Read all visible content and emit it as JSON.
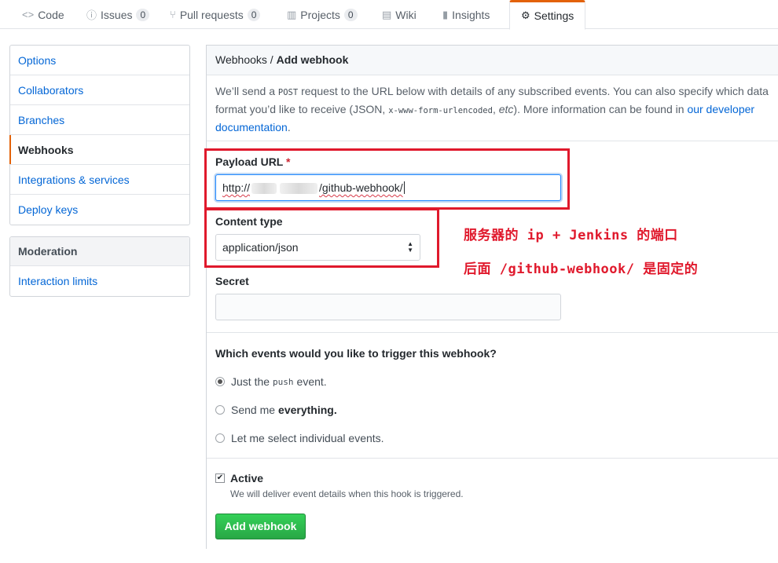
{
  "nav": {
    "tabs": [
      {
        "icon": "code-icon",
        "glyph": "<>",
        "label": "Code"
      },
      {
        "icon": "issue-icon",
        "glyph": "ⓘ",
        "label": "Issues",
        "count": "0"
      },
      {
        "icon": "pull-request-icon",
        "glyph": "⑂",
        "label": "Pull requests",
        "count": "0"
      },
      {
        "icon": "project-icon",
        "glyph": "▥",
        "label": "Projects",
        "count": "0"
      },
      {
        "icon": "wiki-icon",
        "glyph": "▤",
        "label": "Wiki"
      },
      {
        "icon": "graph-icon",
        "glyph": "▮",
        "label": "Insights"
      },
      {
        "icon": "gear-icon",
        "glyph": "⚙",
        "label": "Settings"
      }
    ]
  },
  "sidebar": {
    "items": [
      "Options",
      "Collaborators",
      "Branches",
      "Webhooks",
      "Integrations & services",
      "Deploy keys"
    ],
    "moderation_heading": "Moderation",
    "moderation_items": [
      "Interaction limits"
    ]
  },
  "panel": {
    "breadcrumb_parent": "Webhooks",
    "breadcrumb_sep": " / ",
    "breadcrumb_current": "Add webhook",
    "intro": {
      "p1": "We’ll send a ",
      "post": "POST",
      "p2": " request to the URL below with details of any subscribed events. You can also specify which data format you’d like to receive (JSON, ",
      "form": "x-www-form-urlencoded",
      "p3": ", ",
      "etc": "etc",
      "p4": "). More information can be found in ",
      "link": "our developer documentation",
      "p5": "."
    },
    "payload_label": "Payload URL",
    "required_mark": "*",
    "payload_prefix": "http://",
    "payload_suffix": "/github-webhook/",
    "content_type_label": "Content type",
    "content_type_value": "application/json",
    "secret_label": "Secret",
    "secret_value": "",
    "events_question": "Which events would you like to trigger this webhook?",
    "events": {
      "opt1_a": "Just the",
      "opt1_code": "push",
      "opt1_b": "event.",
      "opt2_a": "Send me",
      "opt2_b": "everything.",
      "opt3": "Let me select individual events.",
      "selected": "push"
    },
    "active_label": "Active",
    "active_checked": true,
    "active_note": "We will deliver event details when this hook is triggered.",
    "submit_label": "Add webhook"
  },
  "annotations": {
    "line1": "服务器的 ip + Jenkins 的端口",
    "line2": "后面 /github-webhook/ 是固定的",
    "color": "#e0192c"
  }
}
